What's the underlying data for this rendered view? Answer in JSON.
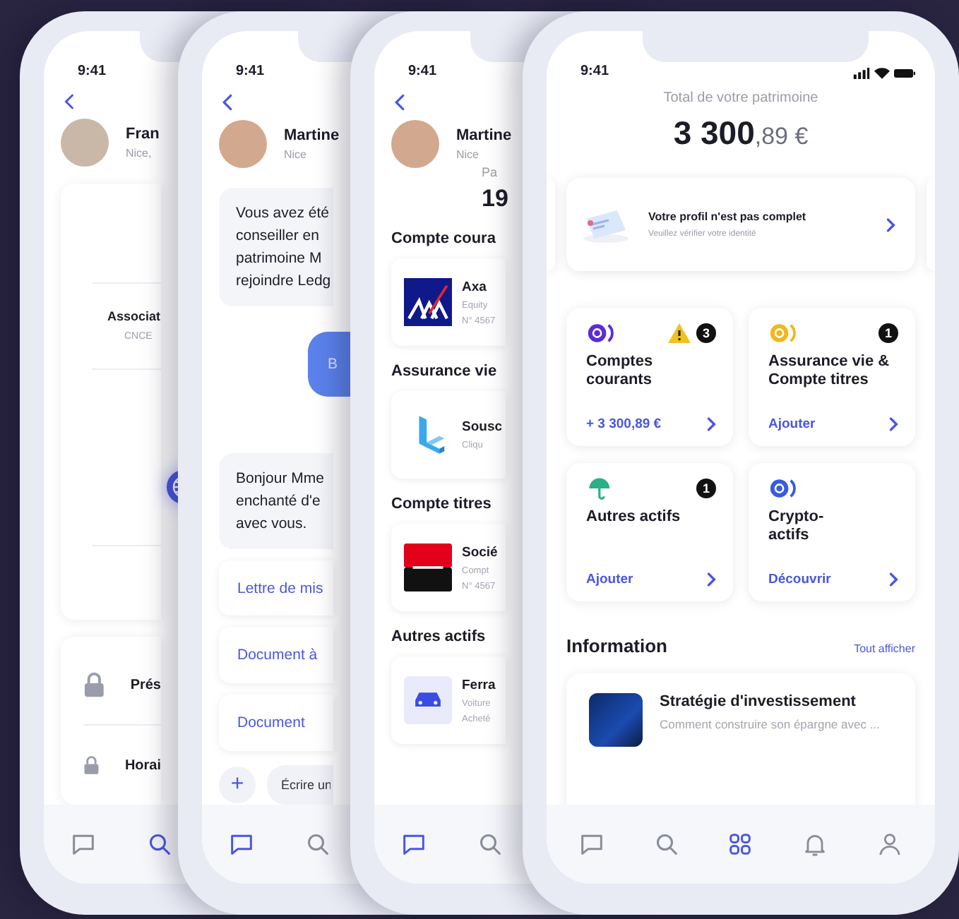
{
  "advisor_screen": {
    "time": "9:41",
    "name": "Fran",
    "subtitle": "Nice,",
    "detail": {
      "title": "Associat",
      "subtitle": "CNCE"
    },
    "rows": [
      {
        "kind": "lock",
        "label": "Prés"
      },
      {
        "kind": "lock",
        "label": "Horai"
      }
    ],
    "nav": [
      {
        "kind": "chat",
        "selected": false
      },
      {
        "kind": "search",
        "selected": true
      }
    ]
  },
  "chat_screen": {
    "time": "9:41",
    "name": "Martine",
    "subtitle": "Nice",
    "messages": [
      {
        "kind": "received",
        "text": "Vous avez été\nconseiller en\npatrimoine M\nrejoindre Ledg"
      },
      {
        "kind": "sent",
        "text": "B"
      },
      {
        "kind": "received",
        "text": "Bonjour Mme\nenchanté d'e\navec vous."
      }
    ],
    "documents": [
      "Lettre de mis",
      "Document à",
      "Document"
    ],
    "composer": {
      "add_label": "+",
      "placeholder": "Écrire un"
    },
    "nav": [
      {
        "kind": "chat",
        "selected": true
      },
      {
        "kind": "search",
        "selected": false
      }
    ]
  },
  "portfolio_screen": {
    "time": "9:41",
    "name": "Martine",
    "subtitle": "Nice",
    "total_label": "Pa",
    "total_value": "19",
    "sections": [
      {
        "title": "Compte coura",
        "name": "Axa",
        "lines": [
          "Equity",
          "N° 4567"
        ]
      },
      {
        "title": "Assurance vie",
        "name": "Sousc",
        "lines": [
          "Cliqu"
        ]
      },
      {
        "title": "Compte titres",
        "name": "Socié",
        "lines": [
          "Compt",
          "N° 4567"
        ]
      },
      {
        "title": "Autres actifs",
        "name": "Ferra",
        "lines": [
          "Voiture",
          "Acheté"
        ]
      }
    ],
    "nav": [
      {
        "kind": "chat",
        "selected": true
      },
      {
        "kind": "search",
        "selected": false
      }
    ]
  },
  "home_screen": {
    "time": "9:41",
    "total_label": "Total de votre patrimoine",
    "amount": "3 300",
    "amount_cents": ",89 €",
    "banner": {
      "title": "Votre profil n'est pas complet",
      "subtitle": "Veuillez vérifier votre identité"
    },
    "cards": [
      {
        "color": "#5b2bd8",
        "warning": true,
        "count": "3",
        "title": "Comptes courants",
        "action": "+ 3 300,89 €"
      },
      {
        "color": "#f0b81c",
        "warning": false,
        "count": "1",
        "title": "Assurance vie & Compte titres",
        "action": "Ajouter"
      },
      {
        "color": "#2cae86",
        "warning": false,
        "count": "1",
        "title": "Autres actifs",
        "action": "Ajouter"
      },
      {
        "color": "#3a5be0",
        "warning": false,
        "title": "Crypto-actifs",
        "action": "Découvrir"
      }
    ],
    "information": {
      "title": "Information",
      "link": "Tout afficher",
      "article": {
        "title": "Stratégie d'investissement",
        "summary": "Comment construire son épargne avec ..."
      }
    },
    "nav": [
      {
        "kind": "chat",
        "selected": false
      },
      {
        "kind": "search",
        "selected": false
      },
      {
        "kind": "grid",
        "selected": true
      },
      {
        "kind": "bell",
        "selected": false
      },
      {
        "kind": "profile",
        "selected": false
      }
    ]
  }
}
